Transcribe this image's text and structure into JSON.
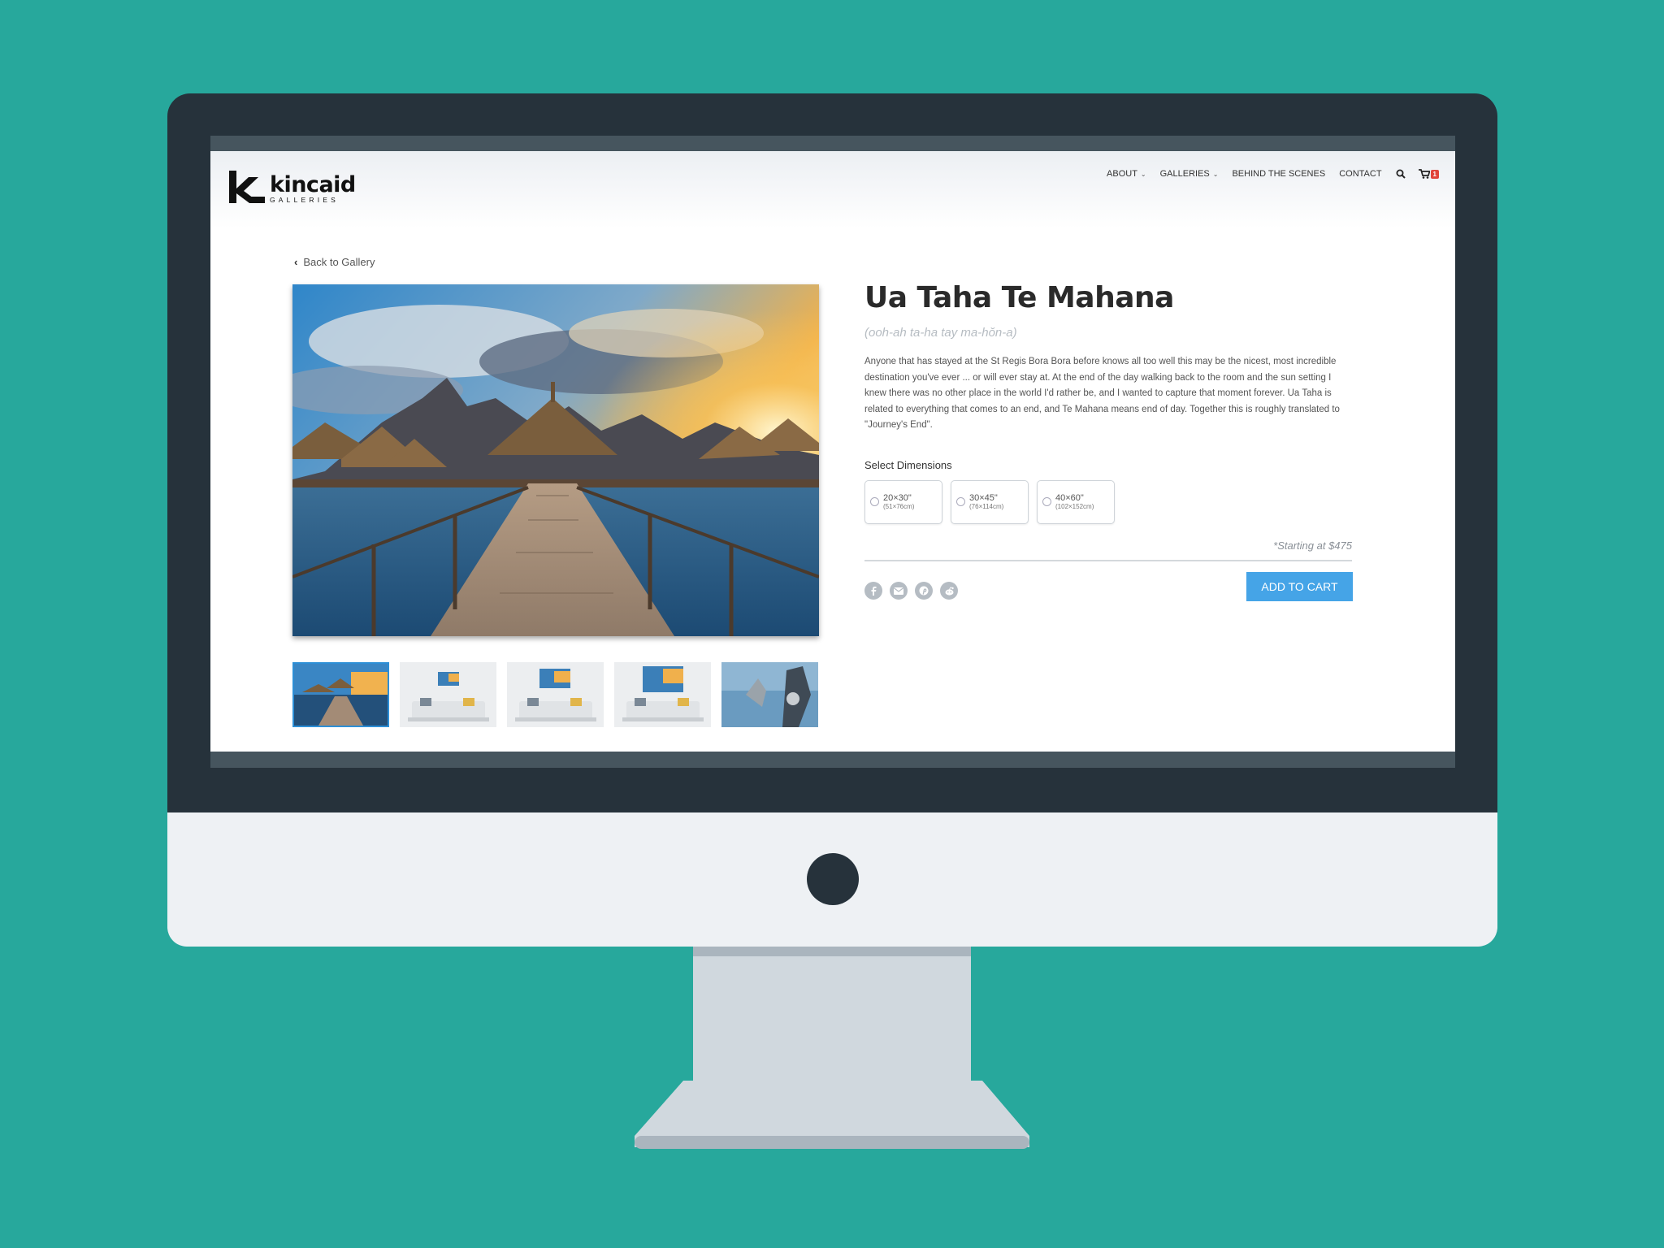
{
  "logo": {
    "word": "kincaid",
    "sub": "GALLERIES"
  },
  "nav": {
    "items": [
      {
        "label": "ABOUT",
        "dropdown": true
      },
      {
        "label": "GALLERIES",
        "dropdown": true
      },
      {
        "label": "BEHIND THE SCENES",
        "dropdown": false
      },
      {
        "label": "CONTACT",
        "dropdown": false
      }
    ],
    "search_icon": "search-icon",
    "cart_icon": "cart-icon",
    "cart_count": "1"
  },
  "back_link": "Back to Gallery",
  "product": {
    "title": "Ua Taha Te Mahana",
    "pronunciation": "(ooh-ah ta-ha tay ma-hŏn-a)",
    "description": "Anyone that has stayed at the St Regis Bora Bora before knows all too well this may be the nicest, most incredible destination you've ever ... or will ever stay at. At the end of the day walking back to the room and the sun setting I knew there was no other place in the world I'd rather be, and I wanted to capture that moment forever. Ua Taha is related to everything that comes to an end, and Te Mahana means end of day. Together this is roughly translated to \"Journey's End\".",
    "dimensions_label": "Select Dimensions",
    "dimensions": [
      {
        "size": "20×30\"",
        "metric": "(51×76cm)"
      },
      {
        "size": "30×45\"",
        "metric": "(76×114cm)"
      },
      {
        "size": "40×60\"",
        "metric": "(102×152cm)"
      }
    ],
    "price_note": "*Starting at $475",
    "add_to_cart": "ADD TO CART",
    "share_icons": [
      "facebook-icon",
      "email-icon",
      "pinterest-icon",
      "reddit-icon"
    ]
  },
  "colors": {
    "background": "#27a89c",
    "bezel": "#26323b",
    "accent": "#45a4e7",
    "badge": "#e0453a"
  }
}
